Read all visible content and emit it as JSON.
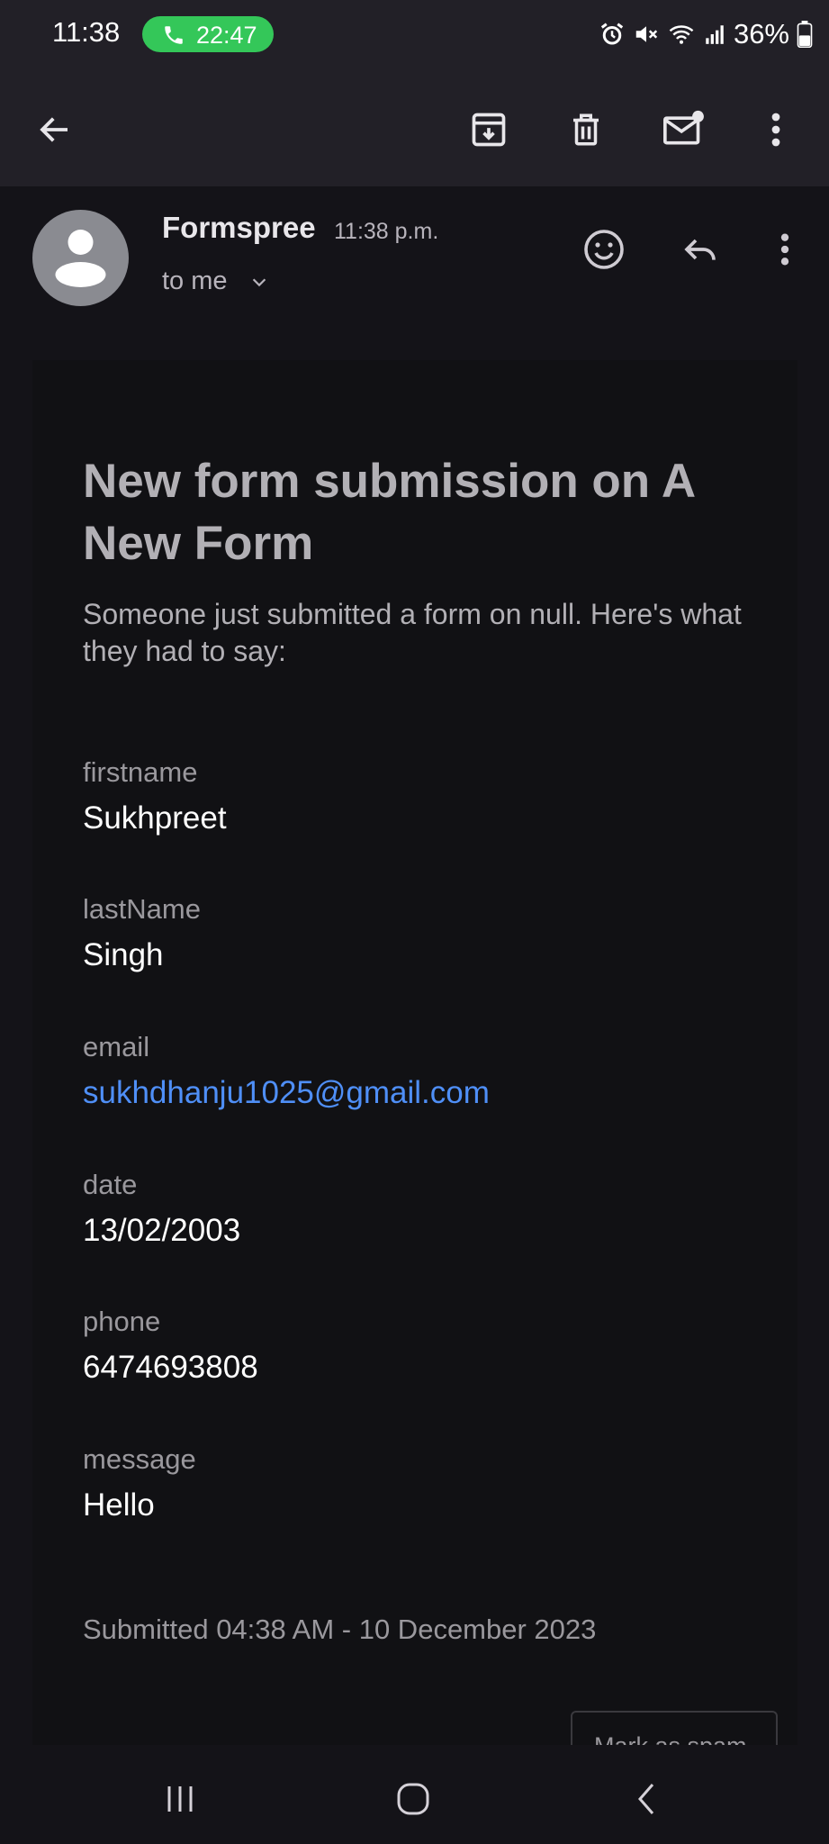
{
  "status_bar": {
    "time": "11:38",
    "call_time": "22:47",
    "battery": "36%",
    "icons": [
      "alarm-icon",
      "mute-icon",
      "wifi-icon",
      "signal-icon",
      "battery-icon"
    ]
  },
  "toolbar": {
    "icons": [
      "back-arrow-icon",
      "archive-icon",
      "delete-icon",
      "mark-unread-icon",
      "more-vert-icon"
    ]
  },
  "email": {
    "sender": "Formspree",
    "time": "11:38 p.m.",
    "recipient": "to me",
    "header_icons": [
      "emoji-reaction-icon",
      "reply-icon",
      "more-vert-icon"
    ]
  },
  "body": {
    "title": "New form submission on A New Form",
    "intro": "Someone just submitted a form on null. Here's what they had to say:",
    "fields": [
      {
        "label": "firstname",
        "value": "Sukhpreet"
      },
      {
        "label": "lastName",
        "value": "Singh"
      },
      {
        "label": "email",
        "value": "sukhdhanju1025@gmail.com"
      },
      {
        "label": "date",
        "value": "13/02/2003"
      },
      {
        "label": "phone",
        "value": "6474693808"
      },
      {
        "label": "message",
        "value": "Hello"
      }
    ],
    "submitted": "Submitted 04:38 AM - 10 December 2023",
    "spam_button": "Mark as spam"
  },
  "nav_bar": {
    "icons": [
      "recent-apps-icon",
      "home-icon",
      "back-icon"
    ]
  },
  "colors": {
    "background": "#141318",
    "bar": "#222027",
    "link": "#4f8ff7",
    "call_pill": "#34c759"
  }
}
